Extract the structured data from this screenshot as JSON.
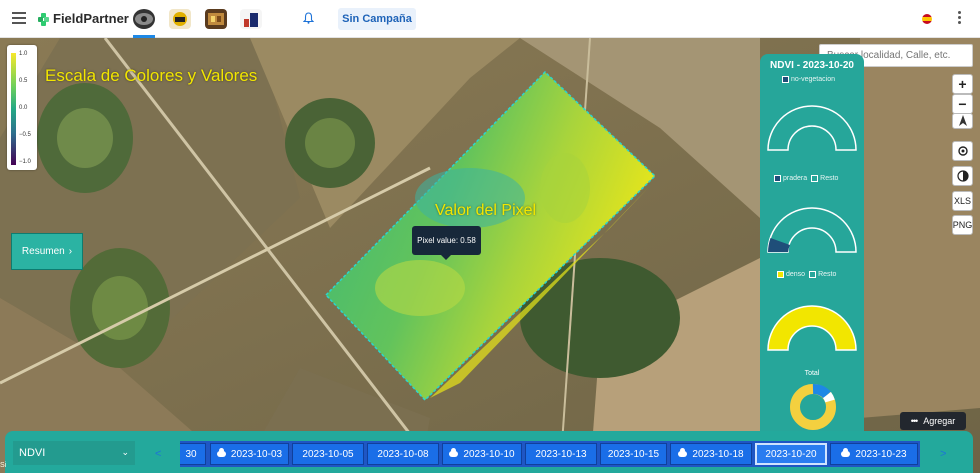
{
  "header": {
    "brand": "FieldPartner",
    "campaign_button": "Sin Campaña",
    "apps": [
      "app-1-icon",
      "app-2-icon",
      "app-3-icon",
      "app-4-icon"
    ]
  },
  "map": {
    "legend": {
      "ticks": [
        "1.0",
        "0.5",
        "0.0",
        "−0.5",
        "−1.0"
      ],
      "colors": [
        "#f7e82b",
        "#6dcf5b",
        "#23a884",
        "#2e6e8e",
        "#440154"
      ]
    },
    "annotation_scale": "Escala de Colores y Valores",
    "annotation_pixel": "Valor del Pixel",
    "tooltip": "Pixel value: 0.58",
    "resumen_button": "Resumen"
  },
  "search": {
    "placeholder": "Buscar localidad, Calle, etc."
  },
  "controls": {
    "zoom_in": "+",
    "zoom_out": "−",
    "xls": "XLS",
    "png": "PNG"
  },
  "ndvi_panel": {
    "title": "NDVI - 2023-10-20",
    "gauges": [
      {
        "legend": [
          "no-vegetacion"
        ],
        "value": 0.0,
        "fill": "#1f4e79"
      },
      {
        "legend": [
          "pradera",
          "Resto"
        ],
        "value": 0.06,
        "fill": "#1f4e79"
      },
      {
        "legend": [
          "denso",
          "Resto"
        ],
        "value": 1.0,
        "fill": "#f2e600"
      }
    ],
    "total_label": "Total",
    "total_donut": {
      "colors": [
        "#f4d03f",
        "#1e88e5",
        "#ffffff"
      ]
    }
  },
  "agregar_button": "Agregar",
  "bottom_bar": {
    "layer": "NDVI",
    "prev": "<",
    "next": ">",
    "dates": [
      {
        "label": "30",
        "cloud": false
      },
      {
        "label": "2023-10-03",
        "cloud": true
      },
      {
        "label": "2023-10-05",
        "cloud": false
      },
      {
        "label": "2023-10-08",
        "cloud": false
      },
      {
        "label": "2023-10-10",
        "cloud": true
      },
      {
        "label": "2023-10-13",
        "cloud": false
      },
      {
        "label": "2023-10-15",
        "cloud": false
      },
      {
        "label": "2023-10-18",
        "cloud": true
      },
      {
        "label": "2023-10-20",
        "cloud": false,
        "selected": true
      },
      {
        "label": "2023-10-23",
        "cloud": true
      }
    ]
  },
  "corner_text": "Si"
}
